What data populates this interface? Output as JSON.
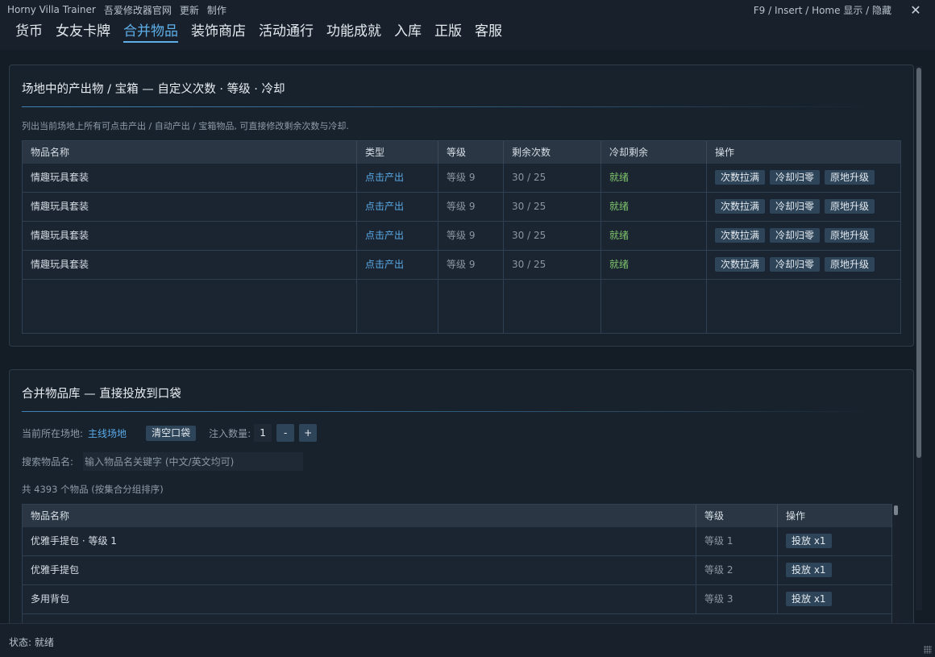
{
  "titlebar": {
    "title": "Horny Villa Trainer",
    "links": [
      "吾爱修改器官网",
      "更新",
      "制作"
    ],
    "hotkey_hint": "F9 / Insert / Home  显示 / 隐藏",
    "close_glyph": "✕"
  },
  "tabs": [
    {
      "label": "货币",
      "active": false
    },
    {
      "label": "女友卡牌",
      "active": false
    },
    {
      "label": "合并物品",
      "active": true
    },
    {
      "label": "装饰商店",
      "active": false
    },
    {
      "label": "活动通行",
      "active": false
    },
    {
      "label": "功能成就",
      "active": false
    },
    {
      "label": "入库",
      "active": false
    },
    {
      "label": "正版",
      "active": false
    },
    {
      "label": "客服",
      "active": false
    }
  ],
  "producers": {
    "title": "场地中的产出物 / 宝箱 — 自定义次数 · 等级 · 冷却",
    "description": "列出当前场地上所有可点击产出 / 自动产出 / 宝箱物品, 可直接修改剩余次数与冷却.",
    "columns": [
      "物品名称",
      "类型",
      "等级",
      "剩余次数",
      "冷却剩余",
      "操作"
    ],
    "rows": [
      {
        "name": "情趣玩具套装",
        "type": "点击产出",
        "level": "等级 9",
        "remaining": "30 / 25",
        "cooldown": "就绪",
        "actions": [
          "次数拉满",
          "冷却归零",
          "原地升级"
        ]
      },
      {
        "name": "情趣玩具套装",
        "type": "点击产出",
        "level": "等级 9",
        "remaining": "30 / 25",
        "cooldown": "就绪",
        "actions": [
          "次数拉满",
          "冷却归零",
          "原地升级"
        ]
      },
      {
        "name": "情趣玩具套装",
        "type": "点击产出",
        "level": "等级 9",
        "remaining": "30 / 25",
        "cooldown": "就绪",
        "actions": [
          "次数拉满",
          "冷却归零",
          "原地升级"
        ]
      },
      {
        "name": "情趣玩具套装",
        "type": "点击产出",
        "level": "等级 9",
        "remaining": "30 / 25",
        "cooldown": "就绪",
        "actions": [
          "次数拉满",
          "冷却归零",
          "原地升级"
        ]
      }
    ]
  },
  "library": {
    "title": "合并物品库 — 直接投放到口袋",
    "current_site_label": "当前所在场地:",
    "current_site": "主线场地",
    "clear_button": "清空口袋",
    "qty_label": "注入数量:",
    "qty_value": "1",
    "minus": "-",
    "plus": "+",
    "search_label": "搜索物品名:",
    "search_placeholder": "输入物品名关键字 (中文/英文均可)",
    "count_text": "共 4393 个物品 (按集合分组排序)",
    "columns": [
      "物品名称",
      "等级",
      "操作"
    ],
    "rows": [
      {
        "name": "优雅手提包 · 等级 1",
        "level": "等级 1",
        "action": "投放 x1"
      },
      {
        "name": "优雅手提包",
        "level": "等级 2",
        "action": "投放 x1"
      },
      {
        "name": "多用背包",
        "level": "等级 3",
        "action": "投放 x1"
      }
    ]
  },
  "status": {
    "text": "状态: 就绪"
  }
}
